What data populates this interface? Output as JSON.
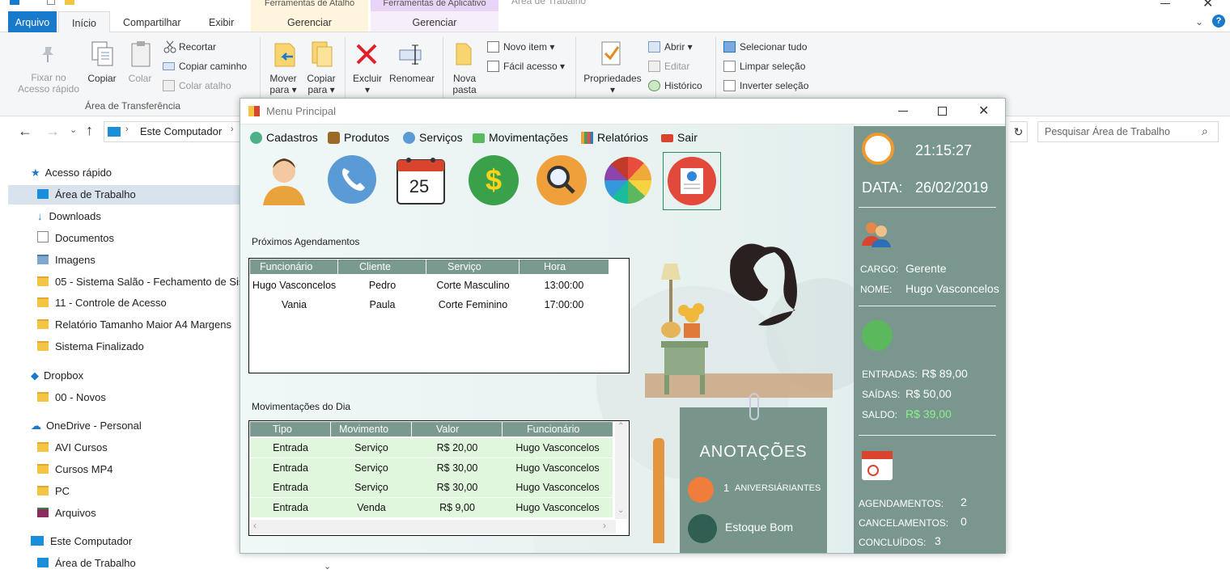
{
  "ribbon": {
    "tabs": [
      "Arquivo",
      "Início",
      "Compartilhar",
      "Exibir"
    ],
    "context": [
      {
        "top": "Ferramentas de Atalho",
        "label": "Gerenciar"
      },
      {
        "top": "Ferramentas de Aplicativo",
        "label": "Gerenciar"
      }
    ],
    "window_title": "Área de Trabalho",
    "pin_label": "Fixar no\nAcesso rápido",
    "copy": "Copiar",
    "paste": "Colar",
    "cut": "Recortar",
    "copy_path": "Copiar caminho",
    "paste_shortcut": "Colar atalho",
    "group_clipboard": "Área de Transferência",
    "move_to": "Mover\npara ▾",
    "copy_to": "Copiar\npara ▾",
    "delete": "Excluir",
    "rename": "Renomear",
    "new_folder": "Nova\npasta",
    "new_item": "Novo item ▾",
    "easy_access": "Fácil acesso ▾",
    "properties": "Propriedades",
    "open": "Abrir ▾",
    "edit": "Editar",
    "history": "Histórico",
    "select_all": "Selecionar tudo",
    "select_none": "Limpar seleção",
    "invert": "Inverter seleção"
  },
  "address": {
    "path": "Este Computador",
    "search_placeholder": "Pesquisar Área de Trabalho"
  },
  "nav": [
    {
      "label": "Acesso rápido",
      "kind": "star"
    },
    {
      "label": "Área de Trabalho",
      "kind": "desktop",
      "selected": true
    },
    {
      "label": "Downloads",
      "kind": "download"
    },
    {
      "label": "Documentos",
      "kind": "doc"
    },
    {
      "label": "Imagens",
      "kind": "img"
    },
    {
      "label": "05 - Sistema Salão - Fechamento de Sis",
      "kind": "folder"
    },
    {
      "label": "11 - Controle de Acesso",
      "kind": "folder"
    },
    {
      "label": "Relatório Tamanho Maior A4 Margens",
      "kind": "folder"
    },
    {
      "label": "Sistema Finalizado",
      "kind": "folder"
    },
    {
      "label": "Dropbox",
      "kind": "dropbox"
    },
    {
      "label": "00 - Novos",
      "kind": "folder-ok"
    },
    {
      "label": "OneDrive - Personal",
      "kind": "cloud"
    },
    {
      "label": "AVI Cursos",
      "kind": "folder"
    },
    {
      "label": "Cursos MP4",
      "kind": "folder"
    },
    {
      "label": "PC",
      "kind": "folder"
    },
    {
      "label": "Arquivos",
      "kind": "books"
    },
    {
      "label": "Este Computador",
      "kind": "pc"
    },
    {
      "label": "Área de Trabalho",
      "kind": "desktop"
    }
  ],
  "app": {
    "title": "Menu Principal",
    "menu": [
      "Cadastros",
      "Produtos",
      "Serviços",
      "Movimentações",
      "Relatórios",
      "Sair"
    ],
    "section_appointments": "Próximos Agendamentos",
    "appointments_headers": [
      "Funcionário",
      "Cliente",
      "Serviço",
      "Hora"
    ],
    "appointments": [
      [
        "Hugo Vasconcelos",
        "Pedro",
        "Corte Masculino",
        "13:00:00"
      ],
      [
        "Vania",
        "Paula",
        "Corte Feminino",
        "17:00:00"
      ]
    ],
    "section_movements": "Movimentações do Dia",
    "movements_headers": [
      "Tipo",
      "Movimento",
      "Valor",
      "Funcionário"
    ],
    "movements": [
      [
        "Entrada",
        "Serviço",
        "R$ 20,00",
        "Hugo Vasconcelos"
      ],
      [
        "Entrada",
        "Serviço",
        "R$ 30,00",
        "Hugo Vasconcelos"
      ],
      [
        "Entrada",
        "Serviço",
        "R$ 30,00",
        "Hugo Vasconcelos"
      ],
      [
        "Entrada",
        "Venda",
        "R$ 9,00",
        "Hugo Vasconcelos"
      ]
    ],
    "calendar_day": "25",
    "notes_title": "ANOTAÇÕES",
    "birthdays_count": "1",
    "birthdays_label": "ANIVERSIÁRIANTES",
    "stock_label": "Estoque Bom",
    "time": "21:15:27",
    "date_label": "DATA:",
    "date": "26/02/2019",
    "cargo_label": "CARGO:",
    "cargo": "Gerente",
    "nome_label": "NOME:",
    "nome": "Hugo Vasconcelos",
    "entradas_label": "ENTRADAS:",
    "entradas": "R$ 89,00",
    "saidas_label": "SAÍDAS:",
    "saidas": "R$ 50,00",
    "saldo_label": "SALDO:",
    "saldo": "R$ 39,00",
    "agend_label": "AGENDAMENTOS:",
    "agend": "2",
    "cancel_label": "CANCELAMENTOS:",
    "cancel": "0",
    "concl_label": "CONCLUÍDOS:",
    "concl": "3"
  }
}
